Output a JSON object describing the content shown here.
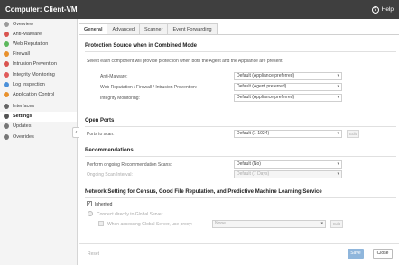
{
  "window": {
    "title": "Computer:  Client-VM",
    "help_label": "Help"
  },
  "sidebar": {
    "items": [
      {
        "label": "Overview",
        "icon": "overview-icon",
        "color": "#9a9a9a",
        "active": false
      },
      {
        "label": "Anti-Malware",
        "icon": "anti-malware-icon",
        "color": "#d9534f",
        "active": false
      },
      {
        "label": "Web Reputation",
        "icon": "web-reputation-icon",
        "color": "#5cb85c",
        "active": false
      },
      {
        "label": "Firewall",
        "icon": "firewall-icon",
        "color": "#e8912d",
        "active": false
      },
      {
        "label": "Intrusion Prevention",
        "icon": "intrusion-prevention-icon",
        "color": "#d9534f",
        "active": false
      },
      {
        "label": "Integrity Monitoring",
        "icon": "integrity-monitoring-icon",
        "color": "#e05a5a",
        "active": false
      },
      {
        "label": "Log Inspection",
        "icon": "log-inspection-icon",
        "color": "#4a90d9",
        "active": false
      },
      {
        "label": "Application Control",
        "icon": "application-control-icon",
        "color": "#e8912d",
        "active": false
      },
      {
        "label": "Interfaces",
        "icon": "interfaces-icon",
        "color": "#666666",
        "active": false
      },
      {
        "label": "Settings",
        "icon": "settings-gear-icon",
        "color": "#555555",
        "active": true
      },
      {
        "label": "Updates",
        "icon": "updates-icon",
        "color": "#777777",
        "active": false
      },
      {
        "label": "Overrides",
        "icon": "overrides-icon",
        "color": "#777777",
        "active": false
      }
    ]
  },
  "tabs": [
    {
      "label": "General",
      "active": true
    },
    {
      "label": "Advanced",
      "active": false
    },
    {
      "label": "Scanner",
      "active": false
    },
    {
      "label": "Event Forwarding",
      "active": false
    }
  ],
  "protection": {
    "heading": "Protection Source when in Combined Mode",
    "description": "Select each component will provide protection when both the Agent and the Appliance are present.",
    "rows": [
      {
        "label": "Anti-Malware:",
        "value": "Default (Appliance preferred)"
      },
      {
        "label": "Web Reputation / Firewall / Intrusion Prevention:",
        "value": "Default (Agent preferred)"
      },
      {
        "label": "Integrity Monitoring:",
        "value": "Default (Appliance preferred)"
      }
    ]
  },
  "open_ports": {
    "heading": "Open Ports",
    "label": "Ports to scan:",
    "value": "Default (1-1024)",
    "edit_label": "Edit"
  },
  "recommendations": {
    "heading": "Recommendations",
    "scan_label": "Perform ongoing Recommendation Scans:",
    "scan_value": "Default (No)",
    "interval_label": "Ongoing Scan Interval:",
    "interval_value": "Default (7 Days)"
  },
  "network": {
    "heading": "Network Setting for Census, Good File Reputation, and Predictive Machine Learning Service",
    "inherited_label": "Inherited",
    "connect_label": "Connect directly to Global Server",
    "proxy_label": "When accessing Global Server, use proxy:",
    "proxy_value": "None",
    "edit_label": "Edit"
  },
  "footer": {
    "reset_label": "Reset",
    "save_label": "Save",
    "close_label": "Close"
  },
  "colors": {
    "titlebar": "#3f3f3f",
    "save_button": "#8fb6dc"
  }
}
